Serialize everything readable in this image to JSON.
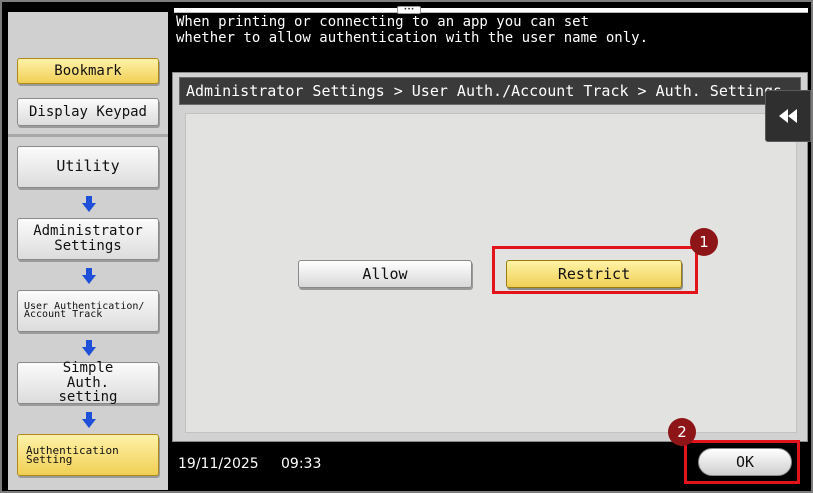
{
  "header": {
    "message": "When printing or connecting to an app you can set\nwhether to allow authentication with the user name only."
  },
  "sidebar": {
    "top_buttons": [
      {
        "label": "Bookmark",
        "active": true
      },
      {
        "label": "Display Keypad",
        "active": false
      }
    ],
    "steps": [
      {
        "label": "Utility",
        "active": false
      },
      {
        "label": "Administrator Settings",
        "active": false
      },
      {
        "label": "User Authentication/ Account Track",
        "active": false
      },
      {
        "label": "Simple Auth. setting",
        "active": false
      },
      {
        "label": "Authentication Setting",
        "active": true
      }
    ]
  },
  "content": {
    "breadcrumb": "Administrator Settings > User Auth./Account Track > Auth. Settings",
    "options": [
      {
        "label": "Allow",
        "selected": false
      },
      {
        "label": "Restrict",
        "selected": true
      }
    ]
  },
  "footer": {
    "date": "19/11/2025",
    "time": "09:33",
    "ok_label": "OK"
  },
  "callouts": [
    "1",
    "2"
  ],
  "colors": {
    "highlight_red": "#e3131b",
    "marker_red": "#8e1517",
    "active_yellow": "#f0cf55",
    "arrow_blue": "#1d4fd8"
  }
}
